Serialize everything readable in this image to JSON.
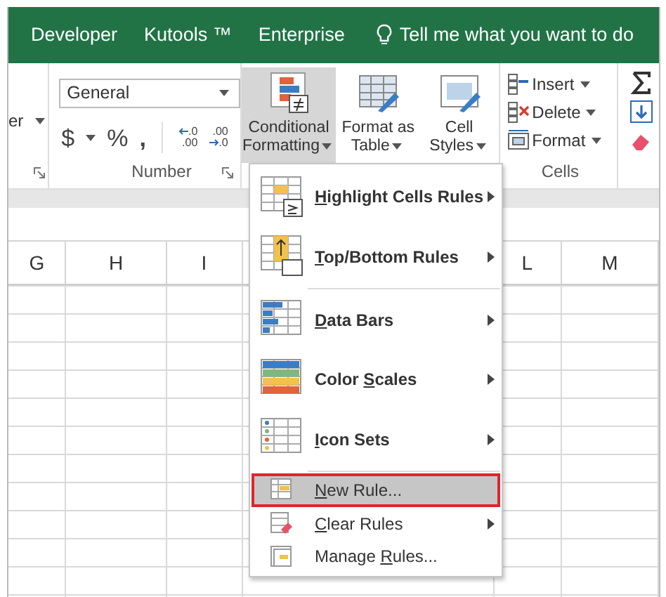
{
  "tabs": [
    {
      "label": "Developer"
    },
    {
      "label": "Kutools ™"
    },
    {
      "label": "Enterprise"
    }
  ],
  "tell_me": "Tell me what you want to do",
  "ribbon": {
    "partial_label": "er",
    "number_group": {
      "format": "General",
      "symbols": [
        "$",
        "%",
        ","
      ],
      "decimals": [
        {
          "top": ".0",
          "bottom": ".00"
        },
        {
          "top": ".00",
          "bottom": ".0"
        }
      ],
      "label": "Number"
    },
    "styles": [
      {
        "lines": [
          "Conditional",
          "Formatting"
        ],
        "selected": true
      },
      {
        "lines": [
          "Format as",
          "Table"
        ],
        "selected": false
      },
      {
        "lines": [
          "Cell",
          "Styles"
        ],
        "selected": false
      }
    ],
    "cells_group": {
      "buttons": [
        {
          "label": "Insert"
        },
        {
          "label": "Delete"
        },
        {
          "label": "Format"
        }
      ],
      "label": "Cells"
    }
  },
  "columns": [
    {
      "label": "G"
    },
    {
      "label": "H"
    },
    {
      "label": "I"
    },
    {
      "label": "L"
    },
    {
      "label": "M"
    }
  ],
  "menu": [
    {
      "kind": "large",
      "label": {
        "key": "H",
        "after": "ighlight Cells Rules"
      },
      "has_submenu": true,
      "selected": false
    },
    {
      "kind": "large",
      "label": {
        "key": "T",
        "after": "op/Bottom Rules"
      },
      "has_submenu": true,
      "selected": false
    },
    {
      "kind": "large",
      "label": {
        "key": "D",
        "after": "ata Bars"
      },
      "has_submenu": true,
      "selected": false
    },
    {
      "kind": "large",
      "label": {
        "before": "Color ",
        "key": "S",
        "after": "cales"
      },
      "has_submenu": true,
      "selected": false
    },
    {
      "kind": "large",
      "label": {
        "key": "I",
        "after": "con Sets"
      },
      "has_submenu": true,
      "selected": false
    },
    {
      "kind": "small",
      "label": {
        "key": "N",
        "after": "ew Rule..."
      },
      "has_submenu": false,
      "selected": true
    },
    {
      "kind": "small",
      "label": {
        "key": "C",
        "after": "lear Rules"
      },
      "has_submenu": true,
      "selected": false
    },
    {
      "kind": "small",
      "label": {
        "before": "Manage ",
        "key": "R",
        "after": "ules..."
      },
      "has_submenu": false,
      "selected": false
    }
  ]
}
